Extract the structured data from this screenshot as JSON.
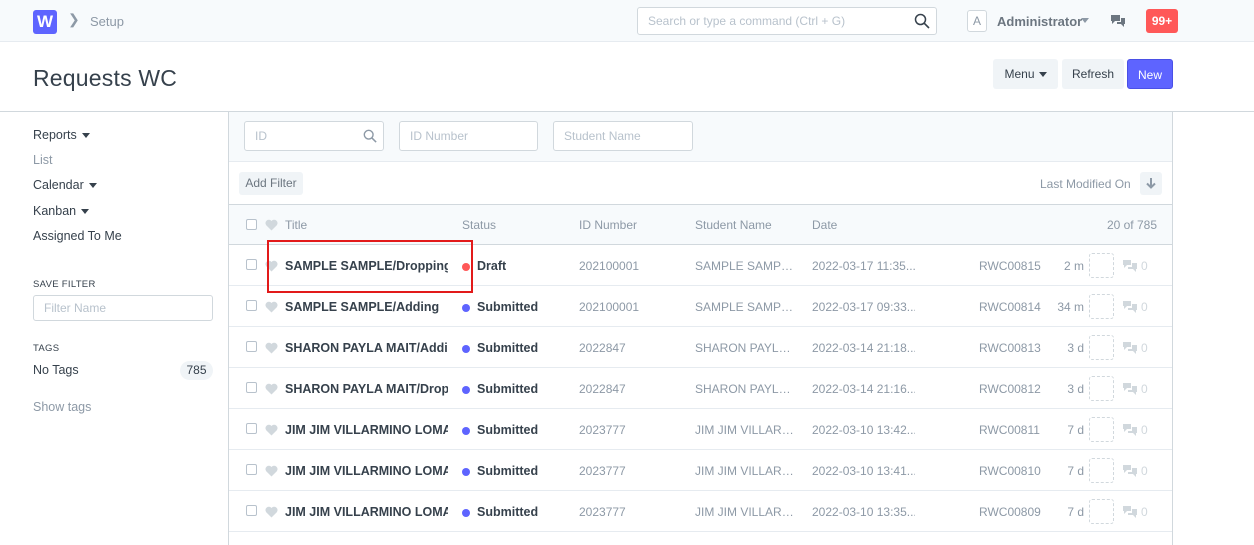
{
  "navbar": {
    "logo_letter": "W",
    "breadcrumb": "Setup",
    "search_placeholder": "Search or type a command (Ctrl + G)",
    "avatar_letter": "A",
    "user_name": "Administrator",
    "notification_count": "99+"
  },
  "page": {
    "title": "Requests WC",
    "menu_label": "Menu",
    "refresh_label": "Refresh",
    "new_label": "New"
  },
  "sidebar": {
    "reports": "Reports",
    "list": "List",
    "calendar": "Calendar",
    "kanban": "Kanban",
    "assigned": "Assigned To Me",
    "save_filter_label": "SAVE FILTER",
    "filter_name_placeholder": "Filter Name",
    "tags_label": "TAGS",
    "no_tags": "No Tags",
    "no_tags_count": "785",
    "show_tags": "Show tags"
  },
  "filters": {
    "id_placeholder": "ID",
    "id_number_placeholder": "ID Number",
    "student_name_placeholder": "Student Name",
    "add_filter": "Add Filter",
    "sort_by": "Last Modified On"
  },
  "list": {
    "headers": {
      "title": "Title",
      "status": "Status",
      "id_number": "ID Number",
      "student_name": "Student Name",
      "date": "Date",
      "count": "20 of 785"
    },
    "rows": [
      {
        "title": "SAMPLE SAMPLE/Dropping",
        "status": "Draft",
        "status_color": "#ff5858",
        "id_number": "202100001",
        "student_name": "SAMPLE SAMPLE",
        "date": "2022-03-17 11:35...",
        "name": "RWC00815",
        "ago": "2 m",
        "comments": "0"
      },
      {
        "title": "SAMPLE SAMPLE/Adding",
        "status": "Submitted",
        "status_color": "#5e64ff",
        "id_number": "202100001",
        "student_name": "SAMPLE SAMPLE",
        "date": "2022-03-17 09:33...",
        "name": "RWC00814",
        "ago": "34 m",
        "comments": "0"
      },
      {
        "title": "SHARON PAYLA MAIT/Adding",
        "status": "Submitted",
        "status_color": "#5e64ff",
        "id_number": "2022847",
        "student_name": "SHARON PAYLA ...",
        "date": "2022-03-14 21:18...",
        "name": "RWC00813",
        "ago": "3 d",
        "comments": "0"
      },
      {
        "title": "SHARON PAYLA MAIT/Dropping",
        "status": "Submitted",
        "status_color": "#5e64ff",
        "id_number": "2022847",
        "student_name": "SHARON PAYLA ...",
        "date": "2022-03-14 21:16...",
        "name": "RWC00812",
        "ago": "3 d",
        "comments": "0"
      },
      {
        "title": "JIM JIM VILLARMINO LOMA/",
        "status": "Submitted",
        "status_color": "#5e64ff",
        "id_number": "2023777",
        "student_name": "JIM JIM VILLARM...",
        "date": "2022-03-10 13:42...",
        "name": "RWC00811",
        "ago": "7 d",
        "comments": "0"
      },
      {
        "title": "JIM JIM VILLARMINO LOMA/",
        "status": "Submitted",
        "status_color": "#5e64ff",
        "id_number": "2023777",
        "student_name": "JIM JIM VILLARM...",
        "date": "2022-03-10 13:41...",
        "name": "RWC00810",
        "ago": "7 d",
        "comments": "0"
      },
      {
        "title": "JIM JIM VILLARMINO LOMA/",
        "status": "Submitted",
        "status_color": "#5e64ff",
        "id_number": "2023777",
        "student_name": "JIM JIM VILLARM...",
        "date": "2022-03-10 13:35...",
        "name": "RWC00809",
        "ago": "7 d",
        "comments": "0"
      }
    ]
  },
  "colors": {
    "accent": "#5e64ff",
    "draft": "#ff5858",
    "highlight": "#e21a1a"
  }
}
